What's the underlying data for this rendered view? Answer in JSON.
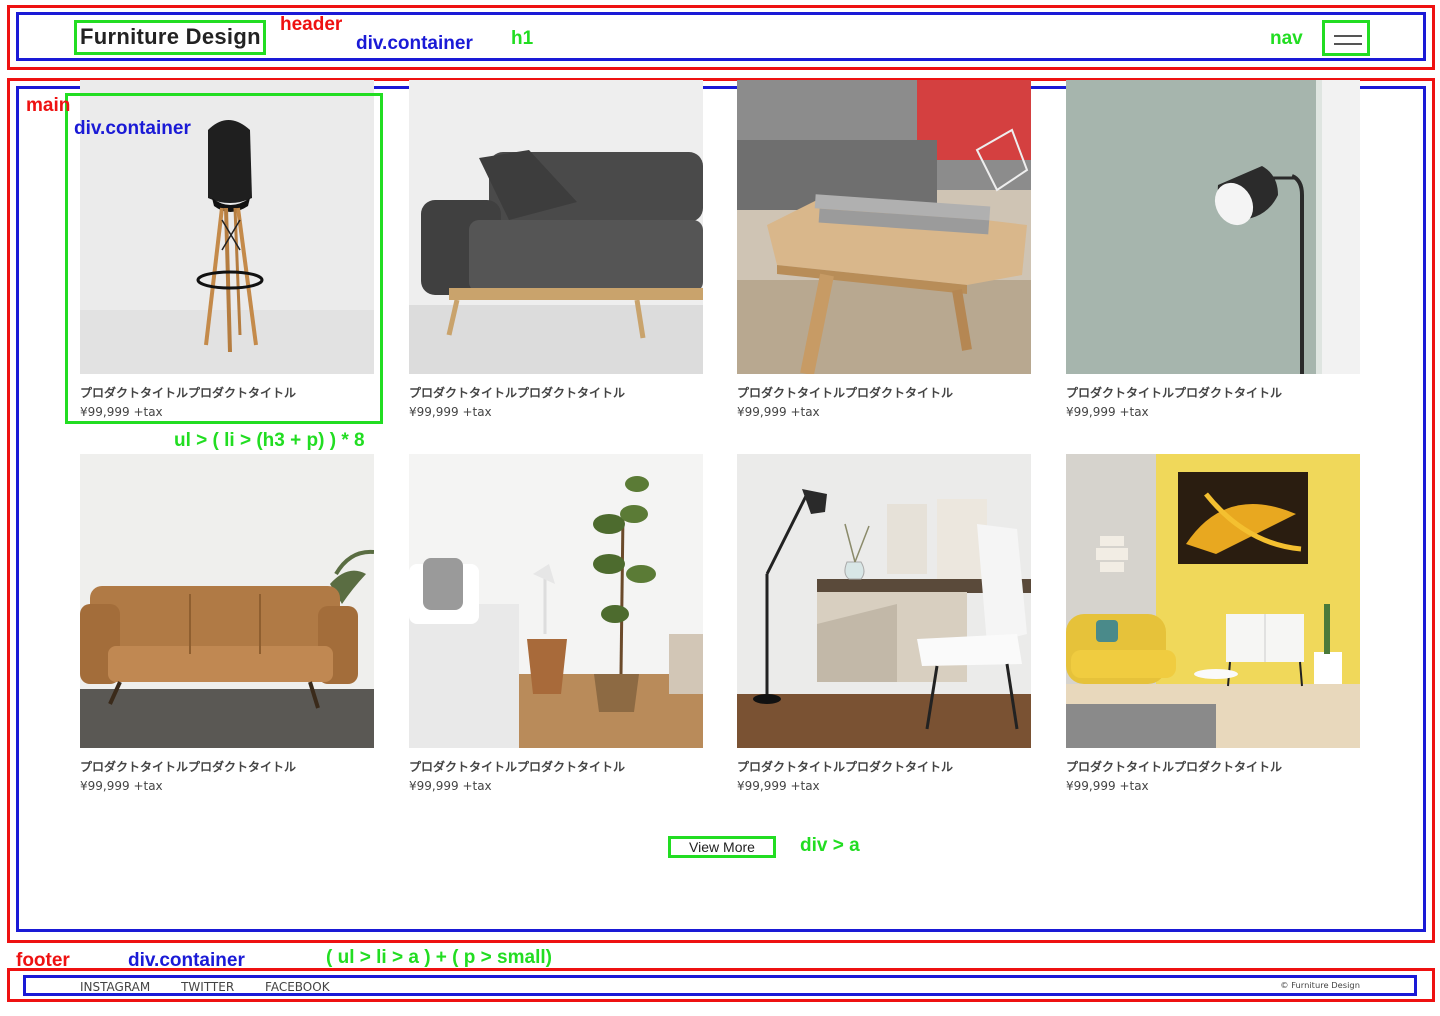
{
  "header": {
    "title": "Furniture Design",
    "menu_icon": "hamburger-icon"
  },
  "annotations": {
    "header": "header",
    "header_container": "div.container",
    "h1": "h1",
    "nav": "nav",
    "main": "main",
    "main_container": "div.container",
    "list": "ul > ( li > (h3 + p) ) * 8",
    "view_more": "div > a",
    "footer": "footer",
    "footer_container": "div.container",
    "footer_structure": "( ul > li > a ) + ( p > small)"
  },
  "products": [
    {
      "title": "プロダクトタイトルプロダクトタイトル",
      "price": "¥99,999 +tax",
      "image": "bar-stool"
    },
    {
      "title": "プロダクトタイトルプロダクトタイトル",
      "price": "¥99,999 +tax",
      "image": "gray-sofa"
    },
    {
      "title": "プロダクトタイトルプロダクトタイトル",
      "price": "¥99,999 +tax",
      "image": "wooden-side-table"
    },
    {
      "title": "プロダクトタイトルプロダクトタイトル",
      "price": "¥99,999 +tax",
      "image": "floor-lamp"
    },
    {
      "title": "プロダクトタイトルプロダクトタイトル",
      "price": "¥99,999 +tax",
      "image": "leather-sofa"
    },
    {
      "title": "プロダクトタイトルプロダクトタイトル",
      "price": "¥99,999 +tax",
      "image": "bedroom-plant"
    },
    {
      "title": "プロダクトタイトルプロダクトタイトル",
      "price": "¥99,999 +tax",
      "image": "desk-chair"
    },
    {
      "title": "プロダクトタイトルプロダクトタイトル",
      "price": "¥99,999 +tax",
      "image": "yellow-living-room"
    }
  ],
  "view_more_label": "View More",
  "footer": {
    "links": [
      "INSTAGRAM",
      "TWITTER",
      "FACEBOOK"
    ],
    "copyright": "© Furniture Design"
  },
  "colors": {
    "annotation_red": "#ee1111",
    "annotation_blue": "#1a1ad6",
    "annotation_green": "#22dd22"
  }
}
